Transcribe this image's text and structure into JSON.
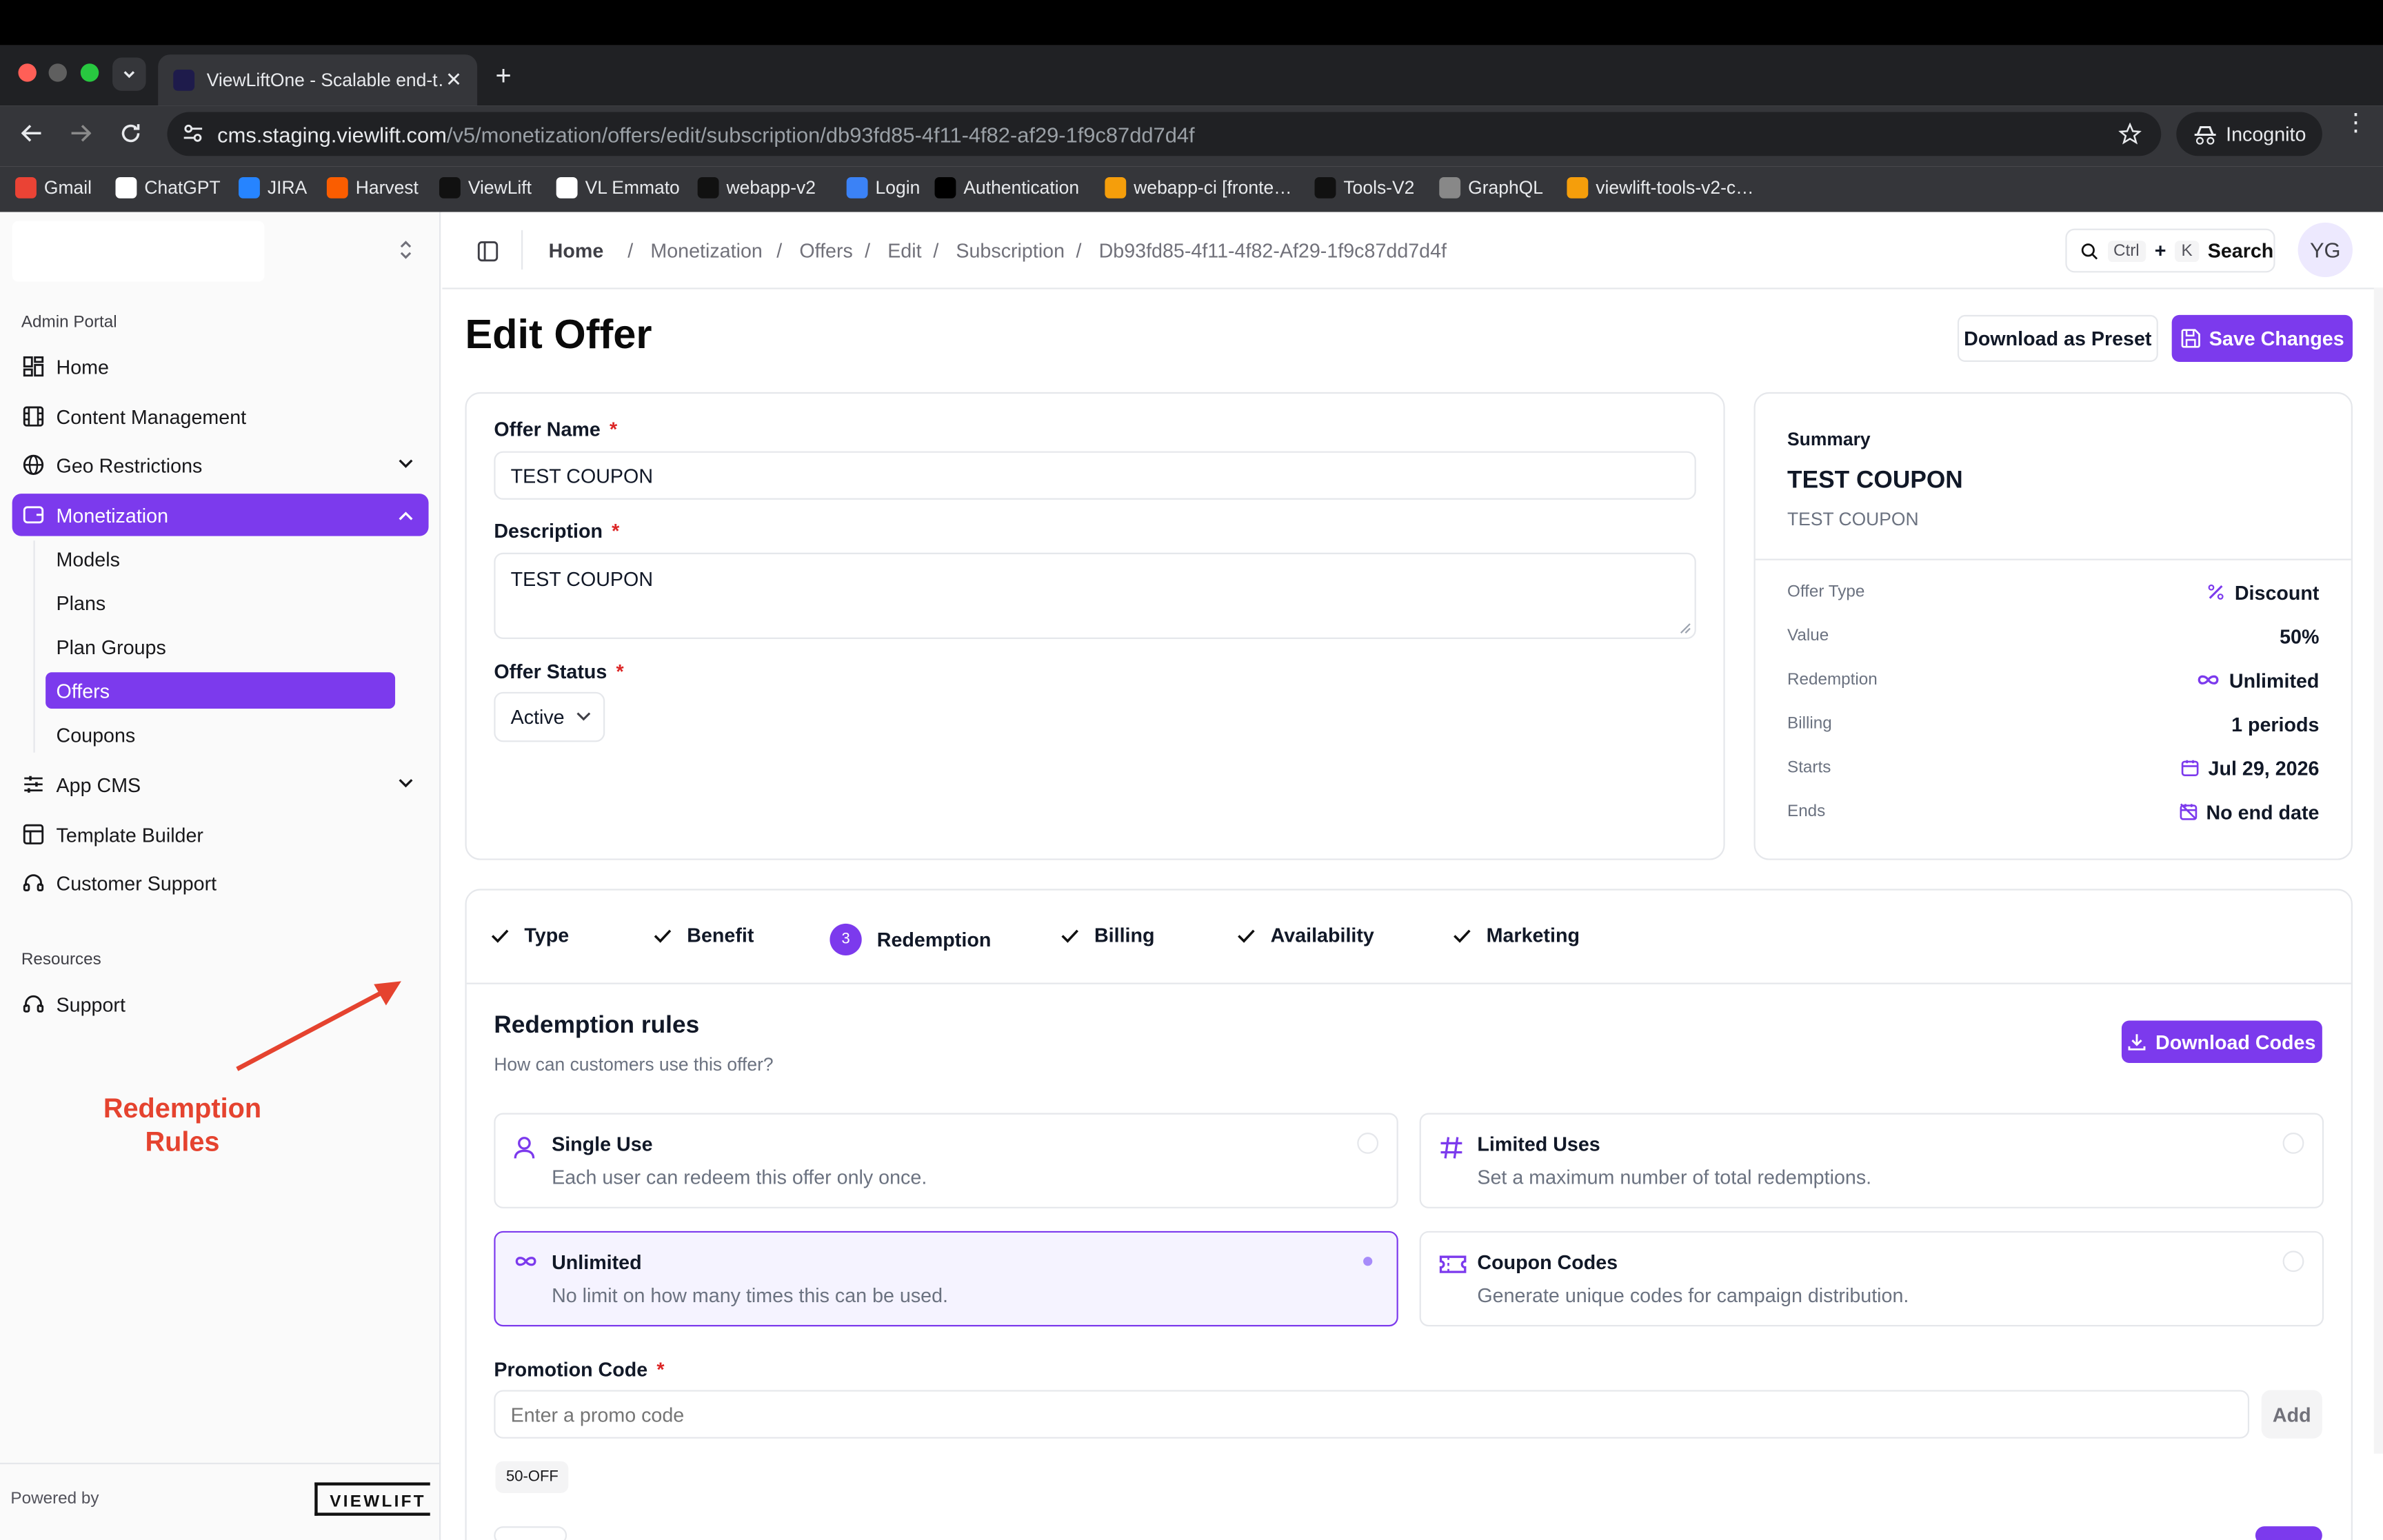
{
  "browser": {
    "tab_title": "ViewLiftOne - Scalable end-t…",
    "url_host": "cms.staging.viewlift.com",
    "url_path": "/v5/monetization/offers/edit/subscription/db93fd85-4f11-4f82-af29-1f9c87dd7d4f",
    "incognito_label": "Incognito",
    "bookmarks": [
      "Gmail",
      "ChatGPT",
      "JIRA",
      "Harvest",
      "ViewLift",
      "VL Emmato",
      "webapp-v2",
      "Login",
      "Authentication",
      "webapp-ci [fronte…",
      "Tools-V2",
      "GraphQL",
      "viewlift-tools-v2-c…"
    ]
  },
  "sidebar": {
    "section_admin": "Admin Portal",
    "items": {
      "home": "Home",
      "content": "Content Management",
      "geo": "Geo Restrictions",
      "monetization": "Monetization",
      "app_cms": "App CMS",
      "template": "Template Builder",
      "support_customer": "Customer Support"
    },
    "sub_items": {
      "models": "Models",
      "plans": "Plans",
      "plan_groups": "Plan Groups",
      "offers": "Offers",
      "coupons": "Coupons"
    },
    "section_resources": "Resources",
    "support": "Support",
    "powered_by": "Powered by",
    "logo_text": "VIEWLIFT",
    "annotation": "Redemption\nRules"
  },
  "header": {
    "breadcrumb": [
      "Home",
      "Monetization",
      "Offers",
      "Edit",
      "Subscription",
      "Db93fd85-4f11-4f82-Af29-1f9c87dd7d4f"
    ],
    "search_key1": "Ctrl",
    "search_plus": "+",
    "search_key2": "K",
    "search_label": "Search",
    "avatar": "YG"
  },
  "page": {
    "title": "Edit Offer",
    "download_preset": "Download as Preset",
    "save_changes": "Save Changes"
  },
  "form": {
    "offer_name_label": "Offer Name",
    "offer_name_value": "TEST COUPON",
    "description_label": "Description",
    "description_value": "TEST COUPON",
    "status_label": "Offer Status",
    "status_value": "Active",
    "required_mark": "*"
  },
  "summary": {
    "heading": "Summary",
    "name": "TEST COUPON",
    "desc": "TEST COUPON",
    "rows": [
      {
        "key": "Offer Type",
        "value": "Discount",
        "icon": "percent-icon"
      },
      {
        "key": "Value",
        "value": "50%",
        "icon": ""
      },
      {
        "key": "Redemption",
        "value": "Unlimited",
        "icon": "infinity-icon"
      },
      {
        "key": "Billing",
        "value": "1 periods",
        "icon": ""
      },
      {
        "key": "Starts",
        "value": "Jul 29, 2026",
        "icon": "calendar-icon"
      },
      {
        "key": "Ends",
        "value": "No end date",
        "icon": "calendar-off-icon"
      }
    ]
  },
  "steps": [
    {
      "label": "Type",
      "state": "done"
    },
    {
      "label": "Benefit",
      "state": "done"
    },
    {
      "label": "Redemption",
      "state": "current",
      "number": "3"
    },
    {
      "label": "Billing",
      "state": "done"
    },
    {
      "label": "Availability",
      "state": "done"
    },
    {
      "label": "Marketing",
      "state": "done"
    }
  ],
  "redemption": {
    "title": "Redemption rules",
    "subtitle": "How can customers use this offer?",
    "download_codes": "Download Codes",
    "options": [
      {
        "title": "Single Use",
        "desc": "Each user can redeem this offer only once.",
        "icon": "user-icon",
        "selected": false
      },
      {
        "title": "Limited Uses",
        "desc": "Set a maximum number of total redemptions.",
        "icon": "hash-icon",
        "selected": false
      },
      {
        "title": "Unlimited",
        "desc": "No limit on how many times this can be used.",
        "icon": "infinity-icon",
        "selected": true
      },
      {
        "title": "Coupon Codes",
        "desc": "Generate unique codes for campaign distribution.",
        "icon": "ticket-icon",
        "selected": false
      }
    ],
    "promo_label": "Promotion Code",
    "promo_placeholder": "Enter a promo code",
    "add_label": "Add",
    "codes": [
      "50-OFF"
    ]
  },
  "colors": {
    "accent": "#7c3aed",
    "annotation": "#e5432f"
  }
}
